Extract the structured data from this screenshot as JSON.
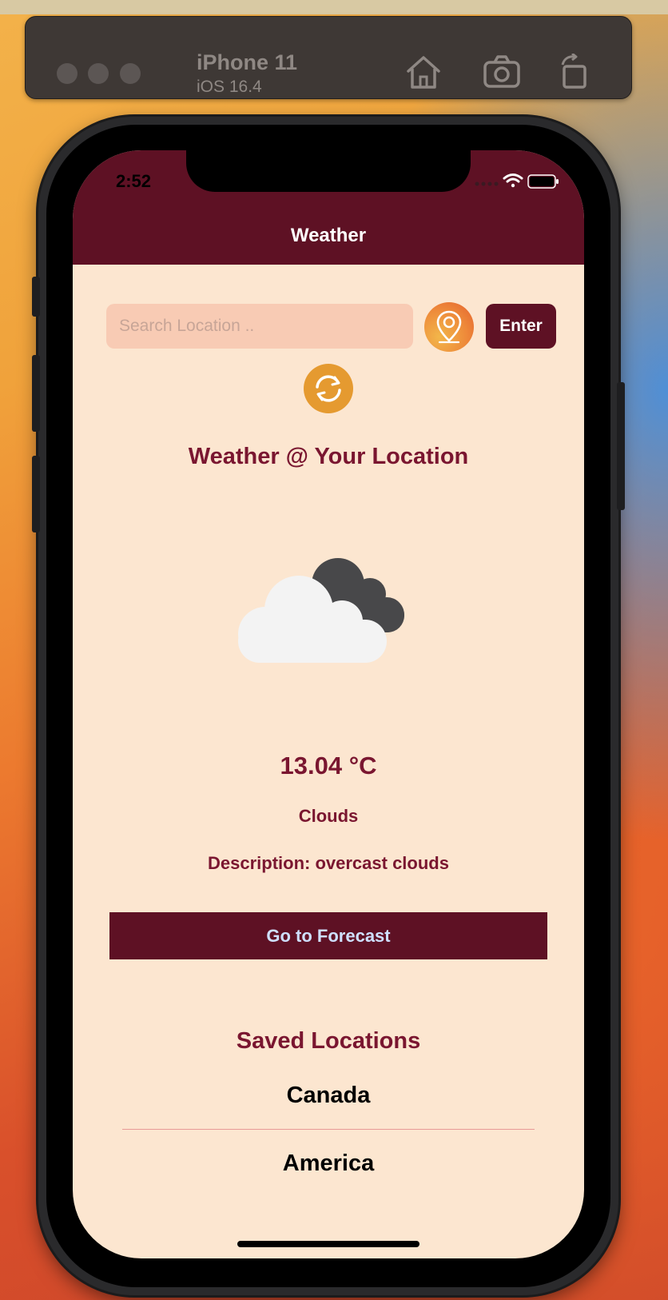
{
  "simulator": {
    "device_name": "iPhone 11",
    "os_version": "iOS 16.4",
    "icons": [
      "home-icon",
      "screenshot-icon",
      "rotate-icon"
    ]
  },
  "status_bar": {
    "time": "2:52"
  },
  "nav": {
    "title": "Weather"
  },
  "search": {
    "placeholder": "Search Location ..",
    "value": "",
    "enter_label": "Enter"
  },
  "current": {
    "heading": "Weather @ Your Location",
    "icon": "cloudy-icon",
    "temperature": "13.04 °C",
    "condition": "Clouds",
    "description": "Description: overcast clouds"
  },
  "forecast_button": {
    "label": "Go to Forecast"
  },
  "saved": {
    "heading": "Saved Locations",
    "items": [
      {
        "label": "Canada"
      },
      {
        "label": "America"
      }
    ]
  },
  "colors": {
    "header": "#5e1124",
    "accent_text": "#7a1630",
    "background": "#fce6d0",
    "search_field": "#f8cbb4",
    "location_button": "#ee8a3a",
    "refresh_button": "#e59a30"
  }
}
